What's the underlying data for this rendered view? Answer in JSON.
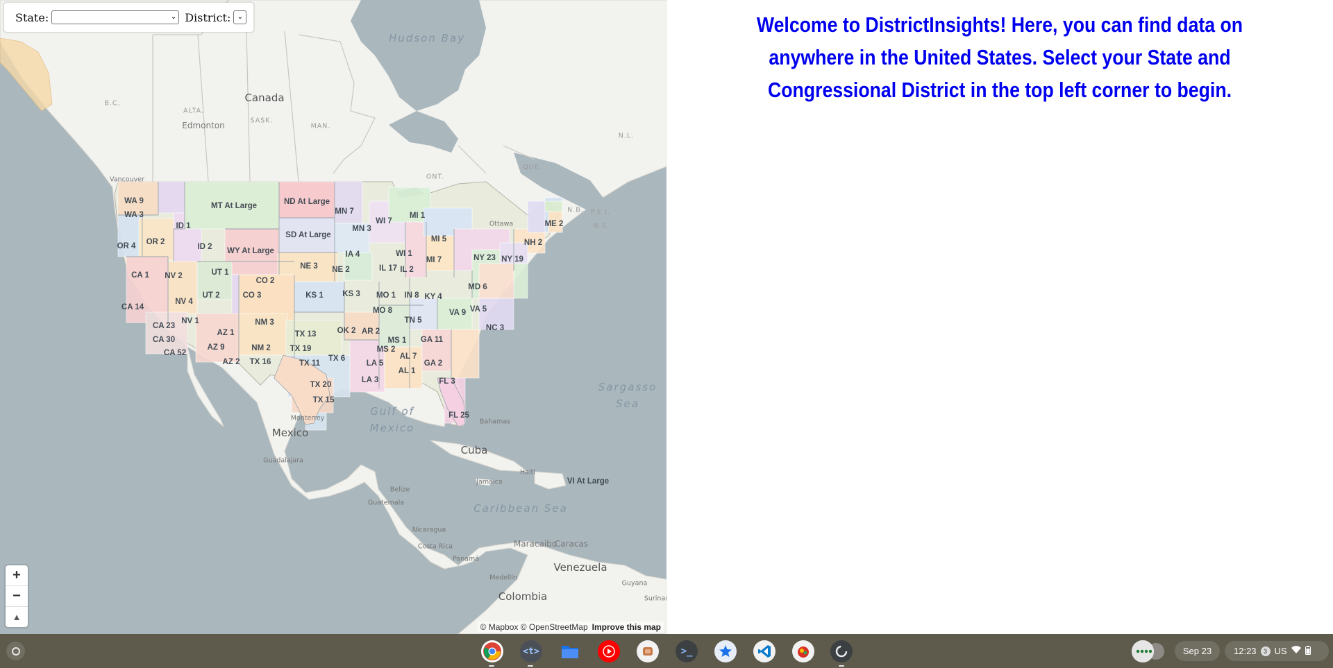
{
  "map": {
    "controls": {
      "state_label": "State:",
      "state_value": "",
      "district_label": "District:",
      "district_value": ""
    },
    "zoom": {
      "in": "+",
      "out": "−",
      "compass": "▲"
    },
    "attribution": {
      "text": "© Mapbox © OpenStreetMap",
      "improve": "Improve this map"
    },
    "places": {
      "canada": "Canada",
      "edmonton": "Edmonton",
      "vancouver": "Vancouver",
      "ottawa": "Ottawa",
      "mexico": "Mexico",
      "monterrey": "Monterrey",
      "guadalajara": "Guadalajara",
      "cuba": "Cuba",
      "haiti": "Haiti",
      "jamaica": "Jamaica",
      "belize": "Belize",
      "guatemala": "Guatemala",
      "nicaragua": "Nicaragua",
      "costa_rica": "Costa Rica",
      "panama": "Panamá",
      "maracaibo": "Maracaibo",
      "caracas": "Caracas",
      "venezuela": "Venezuela",
      "medellin": "Medellín",
      "colombia": "Colombia",
      "guyana": "Guyana",
      "suriname": "Surinar",
      "bahamas": "Bahamas"
    },
    "provinces": {
      "bc": "B.C.",
      "alta": "ALTA.",
      "sask": "SASK.",
      "man": "MAN.",
      "ont": "ONT.",
      "que": "QUE.",
      "nl": "N.L.",
      "nb": "N.B.",
      "pei": "P.E.I.",
      "ns": "N.S."
    },
    "waters": {
      "hudson": "Hudson Bay",
      "gulf": "Gulf of Mexico",
      "sargasso": "Sargasso Sea",
      "caribbean": "Caribbean Sea"
    },
    "districts": {
      "wa9": "WA 9",
      "wa3": "WA 3",
      "or4": "OR 4",
      "or2": "OR 2",
      "id1": "ID 1",
      "id2": "ID 2",
      "mt": "MT At Large",
      "nd": "ND At Large",
      "sd": "SD At Large",
      "wy": "WY At Large",
      "mn7": "MN 7",
      "mn3": "MN 3",
      "wi7": "WI 7",
      "mi1": "MI 1",
      "me2": "ME 2",
      "mi5": "MI 5",
      "nh2": "NH 2",
      "ia4": "IA 4",
      "wi1": "WI 1",
      "ny23": "NY 23",
      "ny19": "NY 19",
      "mi7": "MI 7",
      "ne3": "NE 3",
      "ne2": "NE 2",
      "il17": "IL 17",
      "il2": "IL 2",
      "ut1": "UT 1",
      "ca1": "CA 1",
      "nv2": "NV 2",
      "co2": "CO 2",
      "ut2": "UT 2",
      "co3": "CO 3",
      "ks1": "KS 1",
      "ks3": "KS 3",
      "mo1": "MO 1",
      "in8": "IN 8",
      "ky4": "KY 4",
      "md6": "MD 6",
      "nv4": "NV 4",
      "ca14": "CA 14",
      "mo8": "MO 8",
      "va9": "VA 9",
      "va5": "VA 5",
      "nm3": "NM 3",
      "nv1": "NV 1",
      "ca23": "CA 23",
      "tn5": "TN 5",
      "nc3": "NC 3",
      "az1": "AZ 1",
      "tx13": "TX 13",
      "ok2": "OK 2",
      "ar2": "AR 2",
      "ca30": "CA 30",
      "ms1": "MS 1",
      "ga11": "GA 11",
      "az9": "AZ 9",
      "nm2": "NM 2",
      "tx19": "TX 19",
      "ms2": "MS 2",
      "ca52": "CA 52",
      "al7": "AL 7",
      "az2": "AZ 2",
      "tx16": "TX 16",
      "tx6": "TX 6",
      "tx11": "TX 11",
      "la5": "LA 5",
      "ga2": "GA 2",
      "al1": "AL 1",
      "la3": "LA 3",
      "fl3": "FL 3",
      "tx20": "TX 20",
      "tx15": "TX 15",
      "fl25": "FL 25",
      "vi": "VI At Large"
    }
  },
  "welcome": {
    "text": "Welcome to DistrictInsights! Here, you can find data on anywhere in the United States. Select your State and Congressional District in the top left corner to begin."
  },
  "shelf": {
    "apps": [
      {
        "name": "Chrome"
      },
      {
        "name": "Text"
      },
      {
        "name": "Files"
      },
      {
        "name": "YouTube Music"
      },
      {
        "name": "App"
      },
      {
        "name": "Terminal"
      },
      {
        "name": "App"
      },
      {
        "name": "Visual Studio Code"
      },
      {
        "name": "App"
      },
      {
        "name": "App"
      }
    ],
    "date": "Sep 23",
    "time": "12:23",
    "notifications": "3",
    "locale": "US"
  }
}
